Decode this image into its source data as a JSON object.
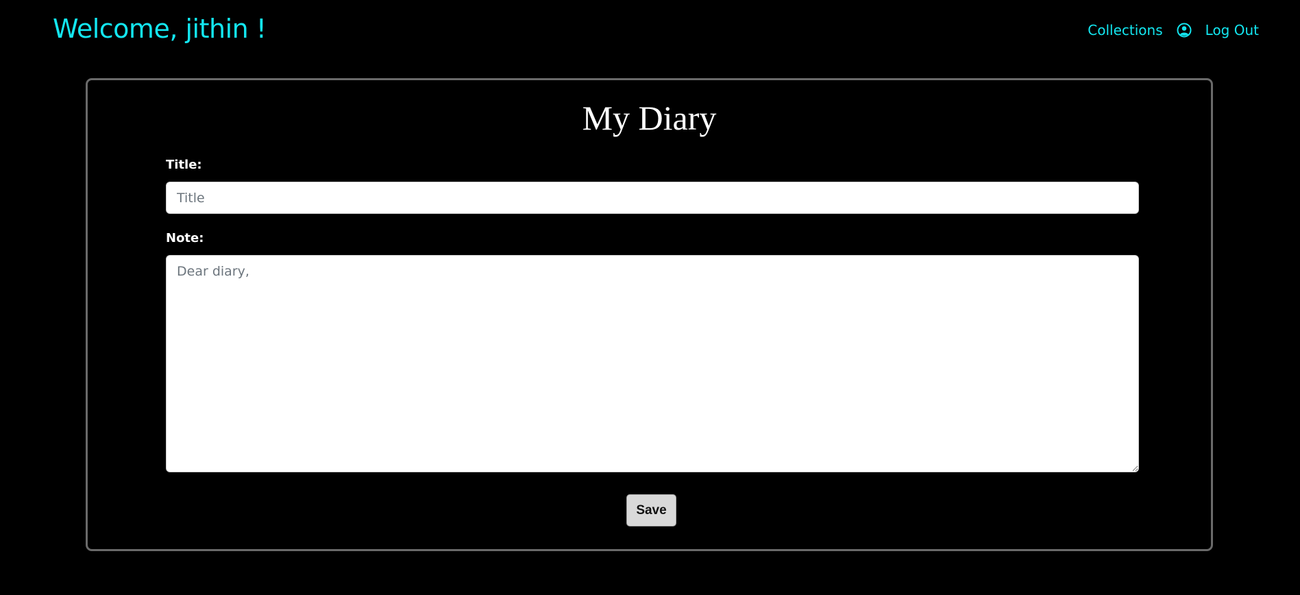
{
  "header": {
    "welcome_text": "Welcome, jithin !",
    "nav": {
      "collections_label": "Collections",
      "user_icon": "user-circle-icon",
      "logout_label": "Log Out"
    },
    "accent_color": "#13e6f0"
  },
  "diary": {
    "heading": "My Diary",
    "title_label": "Title:",
    "title_placeholder": "Title",
    "title_value": "",
    "note_label": "Note:",
    "note_placeholder": "Dear diary,",
    "note_value": "",
    "save_label": "Save"
  }
}
